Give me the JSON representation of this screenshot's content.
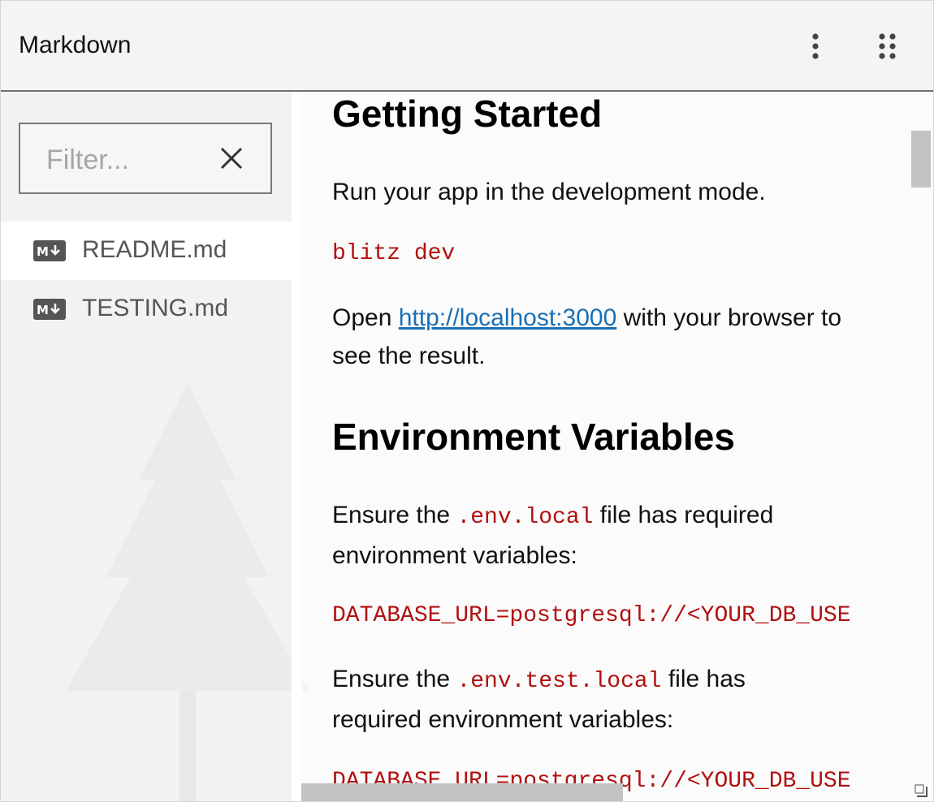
{
  "window": {
    "title": "Markdown"
  },
  "header": {
    "menu_icon": "more-vertical-icon",
    "drag_icon": "drag-grid-icon"
  },
  "sidebar": {
    "filter": {
      "placeholder": "Filter...",
      "value": "",
      "clear_icon": "close-icon"
    },
    "files": [
      {
        "label": "README.md",
        "icon": "markdown-icon",
        "selected": true
      },
      {
        "label": "TESTING.md",
        "icon": "markdown-icon",
        "selected": false
      }
    ]
  },
  "content": {
    "heading1": "Getting Started",
    "p1": "Run your app in the development mode.",
    "code1": "blitz dev",
    "p2_pre": "Open ",
    "p2_link": "http://localhost:3000",
    "p2_post": " with your browser to see the result.",
    "heading2": "Environment Variables",
    "p3_pre": "Ensure the ",
    "p3_code": ".env.local",
    "p3_post": " file has required environment variables:",
    "code2": "DATABASE_URL=postgresql://<YOUR_DB_USE",
    "p4_pre": "Ensure the ",
    "p4_code": ".env.test.local",
    "p4_post": " file has required environment variables:",
    "code3": "DATABASE_URL=postgresql://<YOUR_DB_USE"
  },
  "colors": {
    "code": "#b01010",
    "link": "#1a6fb5",
    "selected_bg": "#ffffff"
  }
}
